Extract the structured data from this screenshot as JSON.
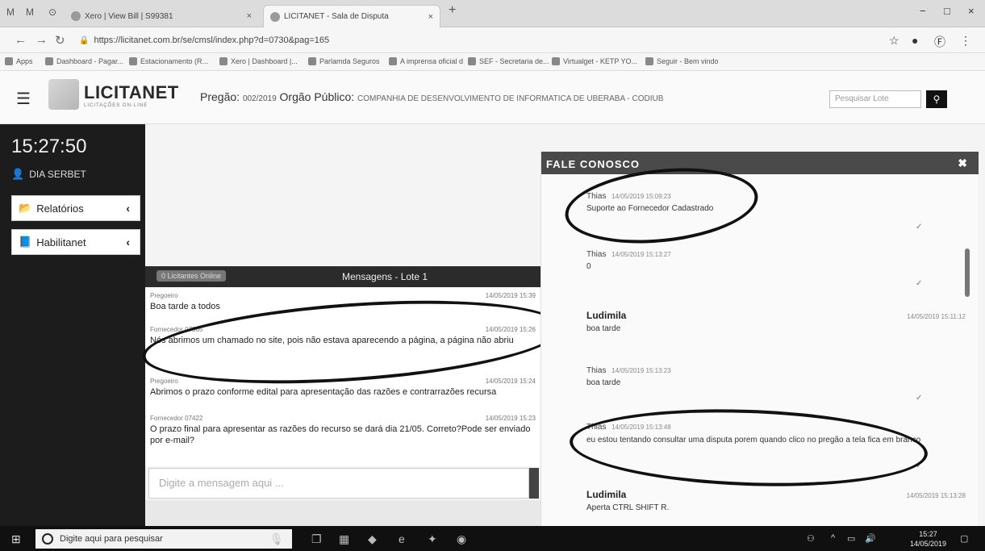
{
  "browser": {
    "tabs": [
      {
        "label": "Xero | View Bill | S99381"
      },
      {
        "label": "LICITANET - Sala de Disputa"
      }
    ],
    "mini_tabs": [
      "M",
      "M"
    ],
    "url": "https://licitanet.com.br/se/cmsl/index.php?d=0730&pag=165",
    "bookmarks": [
      "Apps",
      "Dashboard - Pagar...",
      "Estacionamento (R...",
      "Xero | Dashboard |...",
      "Parlamda Seguros",
      "A imprensa oficial d",
      "SEF - Secretaria de...",
      "Virtualget - KETP YO...",
      "Seguir - Bem vindo"
    ]
  },
  "header": {
    "logo_text": "LICITANET",
    "logo_sub": "LICITAÇÕES ON-LINE",
    "pregao_label": "Pregão:",
    "pregao_number": "002/2019",
    "orgao_label": "Orgão Público:",
    "orgao_name": "COMPANHIA DE DESENVOLVIMENTO DE INFORMATICA DE UBERABA - CODIUB",
    "search_placeholder": "Pesquisar Lote",
    "search_icon": "search-icon"
  },
  "sidebar": {
    "clock": "15:27:50",
    "user": "DIA SERBET",
    "items": [
      {
        "label": "Relatórios",
        "icon": "folder-icon"
      },
      {
        "label": "Habilitanet",
        "icon": "book-icon"
      }
    ]
  },
  "messages": {
    "badge": "0 Licitantes Online",
    "title": "Mensagens - Lote 1",
    "items": [
      {
        "who": "Pregoeiro",
        "when": "14/05/2019 15:39",
        "text": "Boa tarde a todos"
      },
      {
        "who": "Fornecedor 07365",
        "when": "14/05/2019 15:26",
        "text": "Nós abrimos um chamado no site, pois não estava aparecendo a página, a página não abriu"
      },
      {
        "who": "Pregoeiro",
        "when": "14/05/2019 15:24",
        "text": "Abrimos o prazo conforme edital para apresentação das razões e contrarrazões recursa"
      },
      {
        "who": "Fornecedor 07422",
        "when": "14/05/2019 15:23",
        "text": "O prazo final para apresentar as razões do recurso se dará dia 21/05. Correto?Pode ser enviado por e-mail?"
      }
    ],
    "input_placeholder": "Digite a mensagem aqui ..."
  },
  "chat": {
    "title": "FALE CONOSCO",
    "close_icon": "close-icon",
    "items": [
      {
        "name": "Thias",
        "when": "14/05/2019 15:09:23",
        "text": "Suporte ao Fornecedor Cadastrado"
      },
      {
        "name": "Thias",
        "when": "14/05/2019 15:13:27",
        "text": "0"
      },
      {
        "name": "Ludimila",
        "when": "14/05/2019 15:11:12",
        "text": "boa tarde"
      },
      {
        "name": "Thias",
        "when": "14/05/2019 15:13:23",
        "text": "boa tarde"
      },
      {
        "name": "Thias",
        "when": "14/05/2019 15:13:48",
        "text": "eu estou tentando consultar uma disputa porem quando clico no pregão a tela fica em branco"
      },
      {
        "name": "Ludimila",
        "when": "14/05/2019 15:13:28",
        "text": "Aperta CTRL SHIFT R."
      }
    ]
  },
  "taskbar": {
    "search_text": "Digite aqui para pesquisar",
    "time": "15:27",
    "date": "14/05/2019"
  }
}
